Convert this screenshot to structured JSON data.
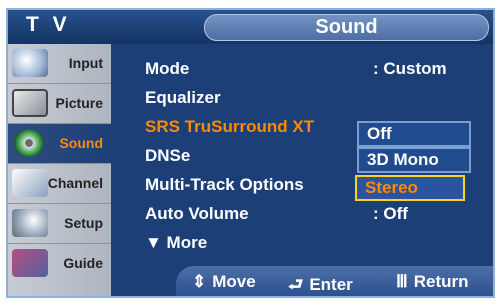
{
  "header": {
    "tv_label": "T V",
    "section_title": "Sound"
  },
  "sidebar": {
    "items": [
      {
        "label": "Input",
        "icon": "input-icon",
        "active": false
      },
      {
        "label": "Picture",
        "icon": "picture-icon",
        "active": false
      },
      {
        "label": "Sound",
        "icon": "sound-icon",
        "active": true
      },
      {
        "label": "Channel",
        "icon": "channel-icon",
        "active": false
      },
      {
        "label": "Setup",
        "icon": "setup-icon",
        "active": false
      },
      {
        "label": "Guide",
        "icon": "guide-icon",
        "active": false
      }
    ]
  },
  "menu": {
    "mode_label": "Mode",
    "mode_value": ": Custom",
    "equalizer_label": "Equalizer",
    "srs_label": "SRS TruSurround XT",
    "srs_colon": ":",
    "dnse_label": "DNSe",
    "multitrack_label": "Multi-Track Options",
    "autovolume_label": "Auto Volume",
    "autovolume_value": ": Off",
    "more_label": "▼ More"
  },
  "dropdown": {
    "options": [
      "Off",
      "3D Mono",
      "Stereo"
    ],
    "selected": "Stereo"
  },
  "footer": {
    "move_icon": "⇕",
    "move_label": "Move",
    "enter_icon": "⮐",
    "enter_label": "Enter",
    "return_icon": "Ⅲ",
    "return_label": "Return"
  },
  "colors": {
    "background": "#1c3f78",
    "highlight": "#ff8a00",
    "selection_border": "#ffd21f"
  }
}
